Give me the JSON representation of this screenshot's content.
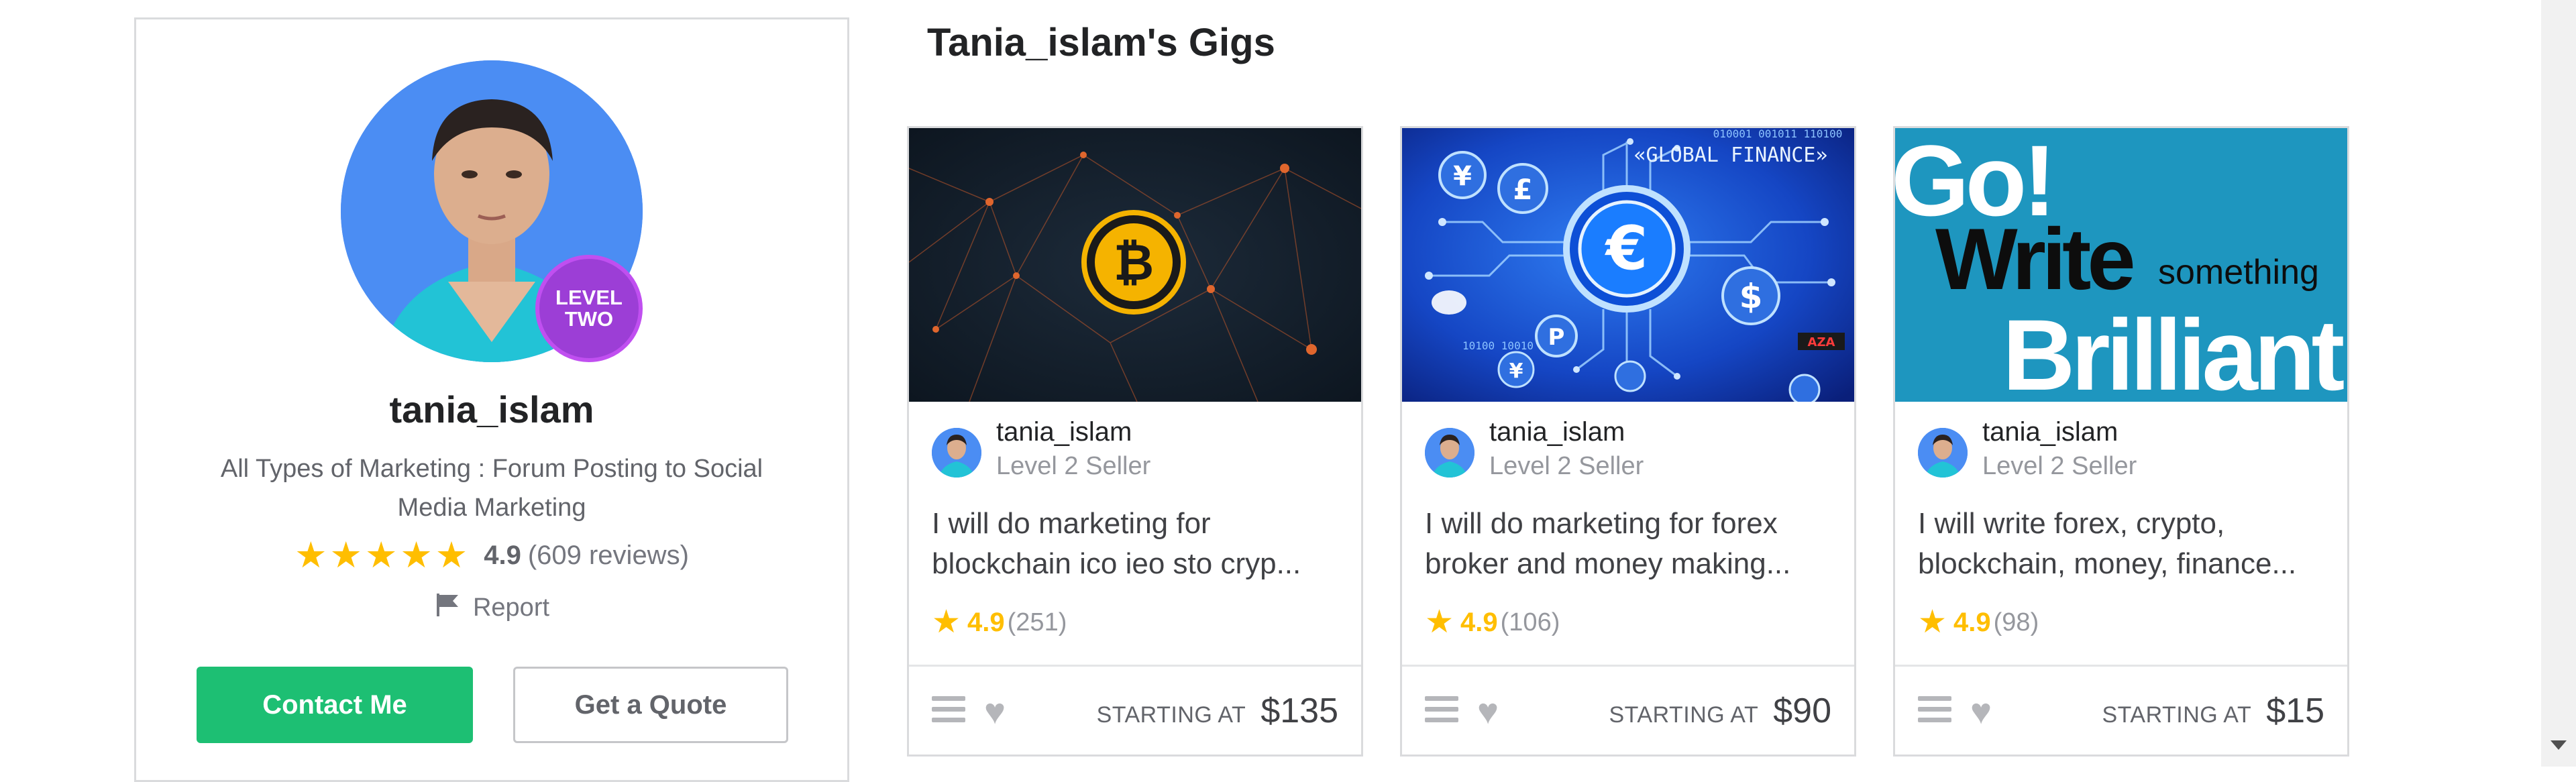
{
  "profile": {
    "username": "tania_islam",
    "tagline": "All Types of Marketing : Forum Posting to Social Media Marketing",
    "badge_line1": "LEVEL",
    "badge_line2": "TWO",
    "rating": "4.9",
    "reviews": "(609 reviews)",
    "stars": 5,
    "report_label": "Report",
    "contact_label": "Contact Me",
    "quote_label": "Get a Quote"
  },
  "gigs_section": {
    "title": "Tania_islam's Gigs",
    "starting_at_label": "STARTING AT",
    "gigs": [
      {
        "seller": "tania_islam",
        "level": "Level 2 Seller",
        "title": "I will do marketing for blockchain ico ieo sto cryp...",
        "rating": "4.9",
        "count": "(251)",
        "price": "$135",
        "thumb_icon": "bitcoin-icon"
      },
      {
        "seller": "tania_islam",
        "level": "Level 2 Seller",
        "title": "I will do marketing for forex broker and money making...",
        "rating": "4.9",
        "count": "(106)",
        "price": "$90",
        "thumb_text": "GLOBAL FINANCE",
        "thumb_icon": "euro-icon"
      },
      {
        "seller": "tania_islam",
        "level": "Level 2 Seller",
        "title": "I will write forex, crypto, blockchain, money, finance...",
        "rating": "4.9",
        "count": "(98)",
        "price": "$15",
        "thumb_line1": "Go!",
        "thumb_line2": "Write",
        "thumb_line3": "something",
        "thumb_line4": "Brilliant"
      }
    ]
  },
  "colors": {
    "primary_green": "#1dbf73",
    "star_yellow": "#ffbe00",
    "badge_purple": "#9c3ed6",
    "text_dark": "#222325",
    "text_muted": "#95979d"
  }
}
